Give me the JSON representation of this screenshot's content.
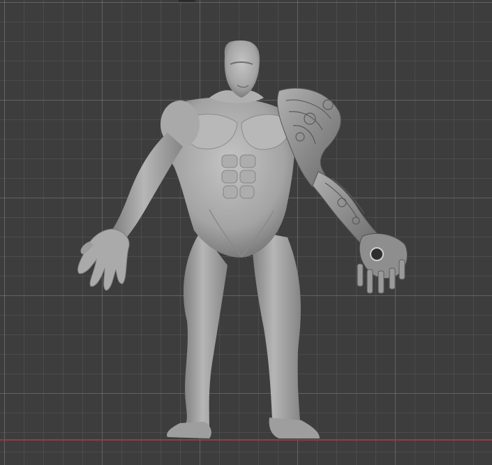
{
  "viewport": {
    "background_color": "#3d3d3d",
    "grid_color": "#4a4a4a",
    "x_axis_color": "#9a3a44"
  },
  "model": {
    "name_semantic": "muscular-figure-with-cybernetic-arm",
    "skin_color": "#a7a7a7",
    "shadow_color": "#6e6e6e",
    "highlight_color": "#c4c4c4"
  }
}
